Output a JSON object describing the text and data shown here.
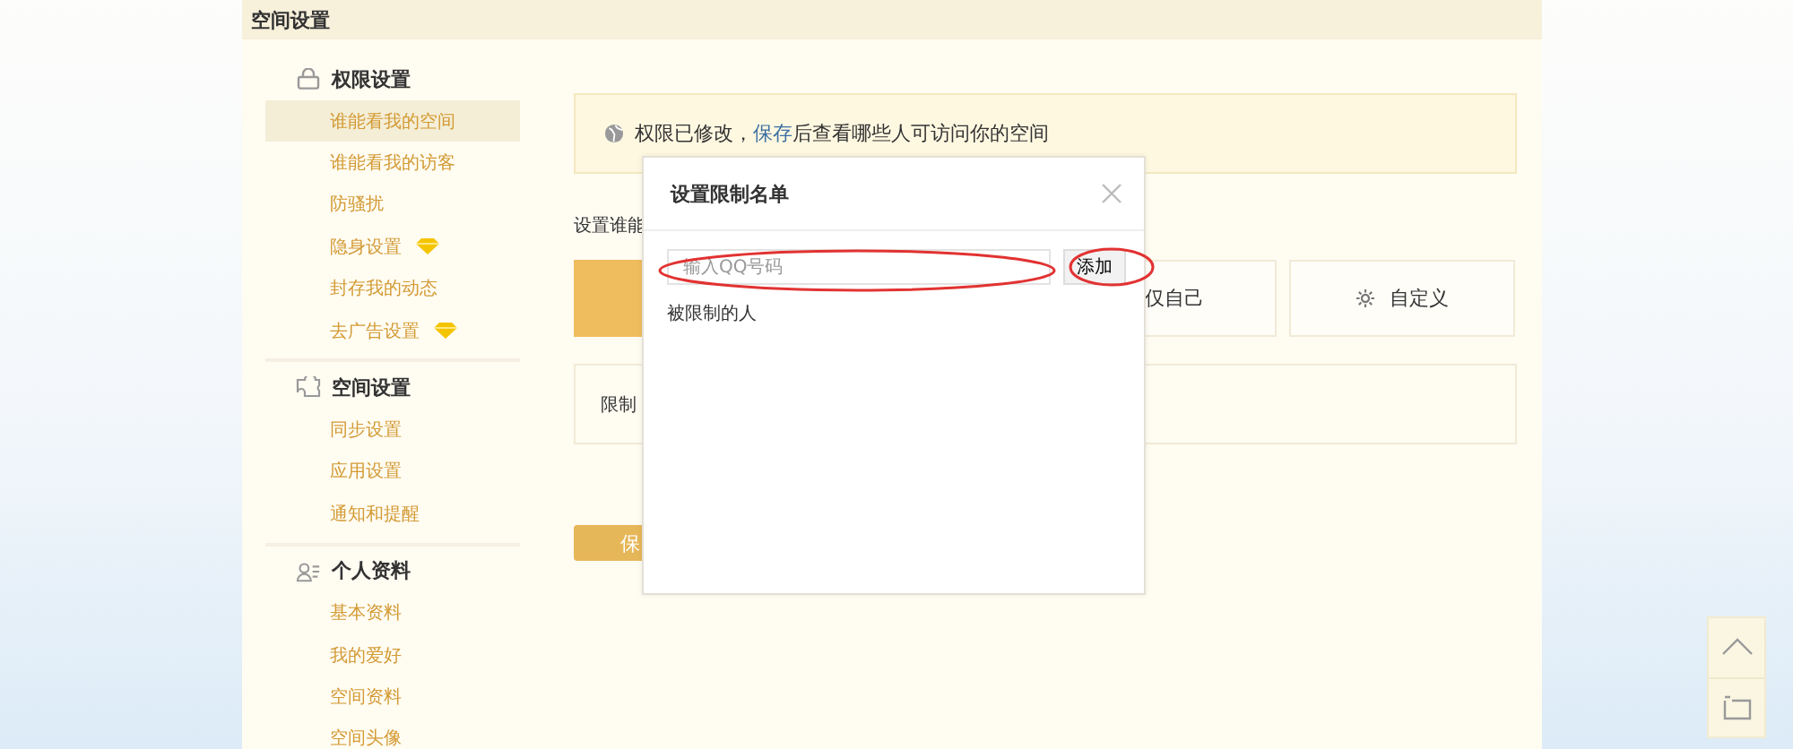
{
  "header": {
    "title": "空间设置"
  },
  "sidebar": {
    "groups": [
      {
        "title": "权限设置",
        "items": [
          {
            "label": "谁能看我的空间",
            "selected": true,
            "vip": false
          },
          {
            "label": "谁能看我的访客",
            "selected": false,
            "vip": false
          },
          {
            "label": "防骚扰",
            "selected": false,
            "vip": false
          },
          {
            "label": "隐身设置",
            "selected": false,
            "vip": true
          },
          {
            "label": "封存我的动态",
            "selected": false,
            "vip": false
          },
          {
            "label": "去广告设置",
            "selected": false,
            "vip": true
          }
        ]
      },
      {
        "title": "空间设置",
        "items": [
          {
            "label": "同步设置",
            "selected": false,
            "vip": false
          },
          {
            "label": "应用设置",
            "selected": false,
            "vip": false
          },
          {
            "label": "通知和提醒",
            "selected": false,
            "vip": false
          }
        ]
      },
      {
        "title": "个人资料",
        "items": [
          {
            "label": "基本资料",
            "selected": false,
            "vip": false
          },
          {
            "label": "我的爱好",
            "selected": false,
            "vip": false
          },
          {
            "label": "空间资料",
            "selected": false,
            "vip": false
          },
          {
            "label": "空间头像",
            "selected": false,
            "vip": false
          }
        ]
      }
    ]
  },
  "notice": {
    "text_before": "权限已修改，",
    "link": "保存",
    "text_after": "后查看哪些人可访问你的空间"
  },
  "section_label": "设置谁能",
  "options": [
    {
      "kind": "plain",
      "selected": true
    },
    {
      "kind": "plain",
      "label": "仅自己",
      "selected": false
    },
    {
      "kind": "gear",
      "label": "自定义",
      "selected": false
    }
  ],
  "restricted_label": "限制",
  "save_button": "保",
  "dialog": {
    "title": "设置限制名单",
    "input_placeholder": "输入QQ号码",
    "add_button": "添加",
    "list_label": "被限制的人"
  }
}
